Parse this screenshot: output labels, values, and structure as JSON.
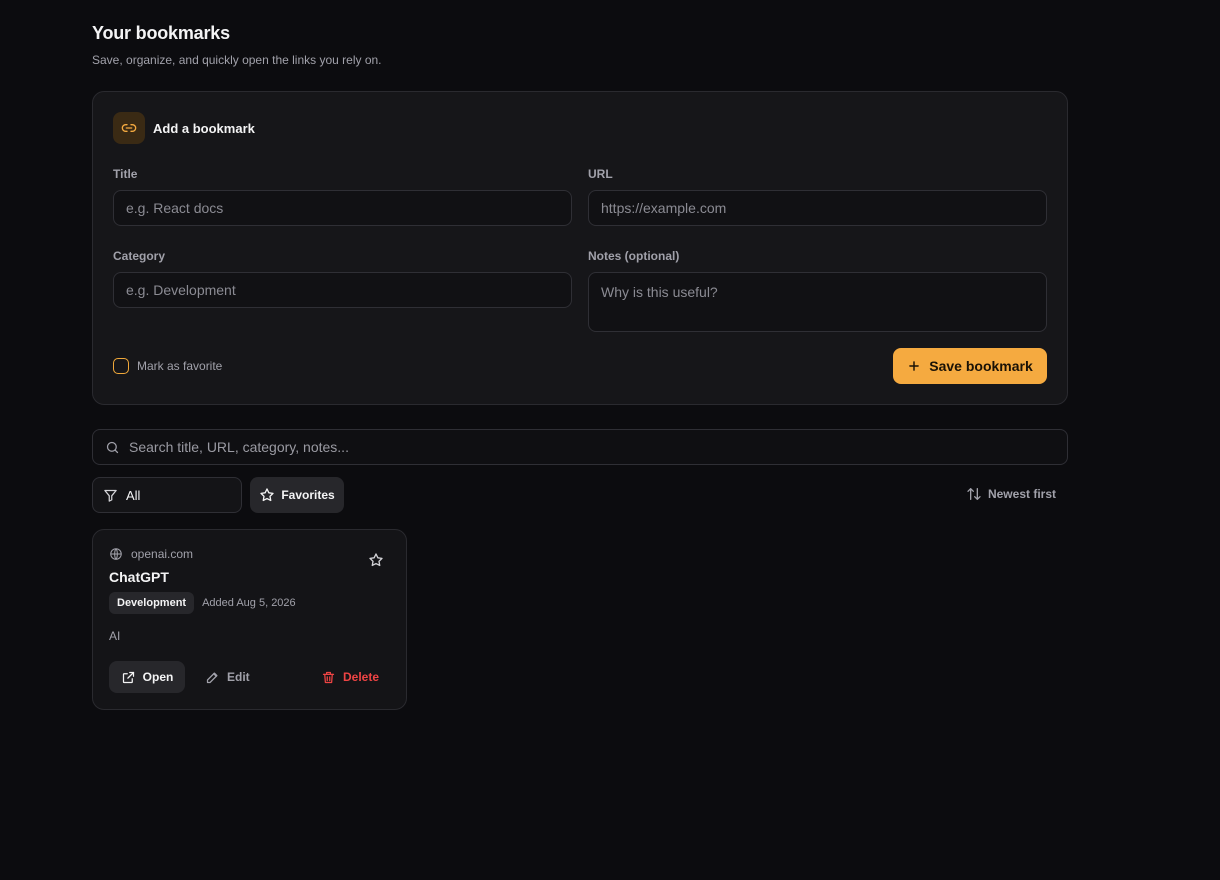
{
  "header": {
    "title": "Your bookmarks",
    "subtitle": "Save, organize, and quickly open the links you rely on."
  },
  "form": {
    "heading": "Add a bookmark",
    "title_label": "Title",
    "title_placeholder": "e.g. React docs",
    "url_label": "URL",
    "url_placeholder": "https://example.com",
    "category_label": "Category",
    "category_placeholder": "e.g. Development",
    "notes_label": "Notes (optional)",
    "notes_placeholder": "Why is this useful?",
    "favorite_label": "Mark as favorite",
    "favorite_checked": false,
    "save_label": "Save bookmark"
  },
  "search": {
    "placeholder": "Search title, URL, category, notes..."
  },
  "filters": {
    "filter_value": "All",
    "favorites_label": "Favorites",
    "sort_label": "Newest first"
  },
  "bookmarks": [
    {
      "domain": "openai.com",
      "title": "ChatGPT",
      "category": "Development",
      "added": "Added Aug 5, 2026",
      "notes": "AI",
      "favorite": false,
      "open_label": "Open",
      "edit_label": "Edit",
      "delete_label": "Delete"
    }
  ],
  "colors": {
    "background": "#0c0c0f",
    "accent": "#f5aa40",
    "danger": "#ef4444"
  },
  "icons": [
    "link-icon",
    "plus-icon",
    "search-icon",
    "filter-icon",
    "star-icon",
    "sort-icon",
    "globe-icon",
    "external-link-icon",
    "pencil-icon",
    "trash-icon"
  ]
}
